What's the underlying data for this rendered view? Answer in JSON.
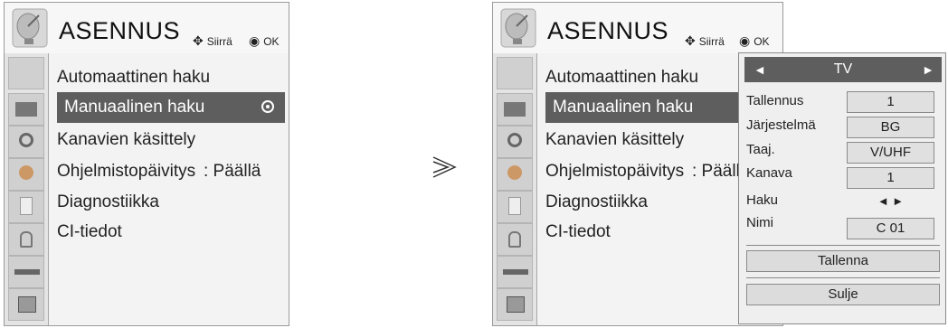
{
  "left": {
    "title": "ASENNUS",
    "hint_move": "Siirrä",
    "hint_ok": "OK",
    "items": [
      {
        "label": "Automaattinen haku"
      },
      {
        "label": "Manuaalinen haku"
      },
      {
        "label": "Kanavien käsittely"
      },
      {
        "label": "Ohjelmistopäivitys",
        "value": ": Päällä"
      },
      {
        "label": "Diagnostiikka"
      },
      {
        "label": "CI-tiedot"
      }
    ]
  },
  "right": {
    "title": "ASENNUS",
    "hint_move": "Siirrä",
    "hint_ok": "OK",
    "items": [
      {
        "label": "Automaattinen haku"
      },
      {
        "label": "Manuaalinen haku"
      },
      {
        "label": "Kanavien käsittely"
      },
      {
        "label": "Ohjelmistopäivitys",
        "value": ": Päällä"
      },
      {
        "label": "Diagnostiikka"
      },
      {
        "label": "CI-tiedot"
      }
    ]
  },
  "arrow_symbol": "≫",
  "dialog": {
    "header": "TV",
    "rows": [
      {
        "label": "Tallennus",
        "value": "1"
      },
      {
        "label": "Järjestelmä",
        "value": "BG"
      },
      {
        "label": "Taaj.",
        "value": "V/UHF"
      },
      {
        "label": "Kanava",
        "value": "1"
      },
      {
        "label": "Haku",
        "value": "◄ ►"
      },
      {
        "label": "Nimi",
        "value": "C 01"
      }
    ],
    "save_button": "Tallenna",
    "close_button": "Sulje"
  },
  "colors": {
    "selected": "#5e5e5e",
    "panel": "#f3f3f3",
    "iconbar": "#e4e4e4"
  }
}
